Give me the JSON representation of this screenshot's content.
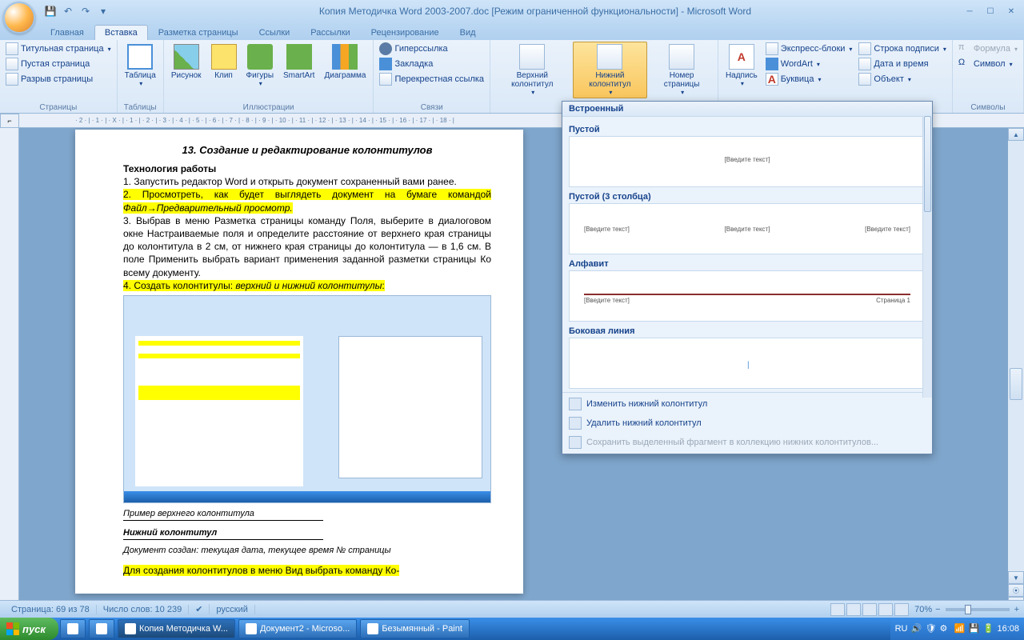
{
  "title": "Копия Методичка Word 2003-2007.doc [Режим ограниченной функциональности] - Microsoft Word",
  "tabs": {
    "t1": "Главная",
    "t2": "Вставка",
    "t3": "Разметка страницы",
    "t4": "Ссылки",
    "t5": "Рассылки",
    "t6": "Рецензирование",
    "t7": "Вид"
  },
  "ribbon": {
    "grp_pages": "Страницы",
    "titlepage": "Титульная страница",
    "blankpage": "Пустая страница",
    "pagebreak": "Разрыв страницы",
    "grp_tables": "Таблицы",
    "table": "Таблица",
    "grp_illus": "Иллюстрации",
    "picture": "Рисунок",
    "clip": "Клип",
    "shapes": "Фигуры",
    "smartart": "SmartArt",
    "chart": "Диаграмма",
    "grp_links": "Связи",
    "hyperlink": "Гиперссылка",
    "bookmark": "Закладка",
    "crossref": "Перекрестная ссылка",
    "grp_hf": "",
    "header": "Верхний колонтитул",
    "footer": "Нижний колонтитул",
    "pagenum": "Номер страницы",
    "grp_text": "",
    "textbox": "Надпись",
    "quickparts": "Экспресс-блоки",
    "wordart": "WordArt",
    "dropcap": "Буквица",
    "sigline": "Строка подписи",
    "datetime": "Дата и время",
    "object": "Объект",
    "grp_symbols": "Символы",
    "equation": "Формула",
    "symbol": "Символ"
  },
  "ruler": " · 2 · | · 1 · | · X · | · 1 · | · 2 · | · 3 · | · 4 · | · 5 · | · 6 · | · 7 · | · 8 · | · 9 · | · 10 · | · 11 · | · 12 · | · 13 · | · 14 · | · 15 · | · 16 · | · 17 · | · 18 · |",
  "doc": {
    "h": "13. Создание и редактирование колонтитулов",
    "tech": "Технология работы",
    "p1": "1. Запустить редактор Word и открыть документ сохраненный вами ранее.",
    "p2a": "2. Просмотреть, как будет выглядеть документ на бумаге командой ",
    "p2b": "Файл→Предварительный просмотр.",
    "p3": "3. Выбрав в меню Разметка страницы команду Поля, выберите в диалоговом окне Настраиваемые поля и определите расстояние от верхнего края страницы до колонтитула в 2 см, от нижнего края страницы до колонтитула — в 1,6 см. В поле Применить выбрать вариант применения заданной разметки страницы Ко всему документу.",
    "p4a": "4. Создать колонтитулы: ",
    "p4b": "верхний и нижний колонтитулы",
    "u1": "Пример верхнего колонтитула",
    "u2": "Нижний колонтитул",
    "u3": "Документ создан:  текущая дата, текущее время          № страницы",
    "p5": "Для создания колонтитулов в меню Вид выбрать команду Ко-"
  },
  "gallery": {
    "hdr": "Встроенный",
    "i1": "Пустой",
    "ph": "[Введите текст]",
    "i2": "Пустой (3 столбца)",
    "i3": "Алфавит",
    "alpage": "Страница 1",
    "i4": "Боковая линия",
    "edit": "Изменить нижний колонтитул",
    "remove": "Удалить нижний колонтитул",
    "save": "Сохранить выделенный фрагмент в коллекцию нижних колонтитулов..."
  },
  "status": {
    "page": "Страница: 69 из 78",
    "words": "Число слов: 10 239",
    "lang": "русский",
    "zoom": "70%"
  },
  "taskbar": {
    "start": "пуск",
    "t1": "Копия Методичка W...",
    "t2": "Документ2 - Microso...",
    "t3": "Безымянный - Paint",
    "lang": "RU",
    "time": "16:08"
  }
}
